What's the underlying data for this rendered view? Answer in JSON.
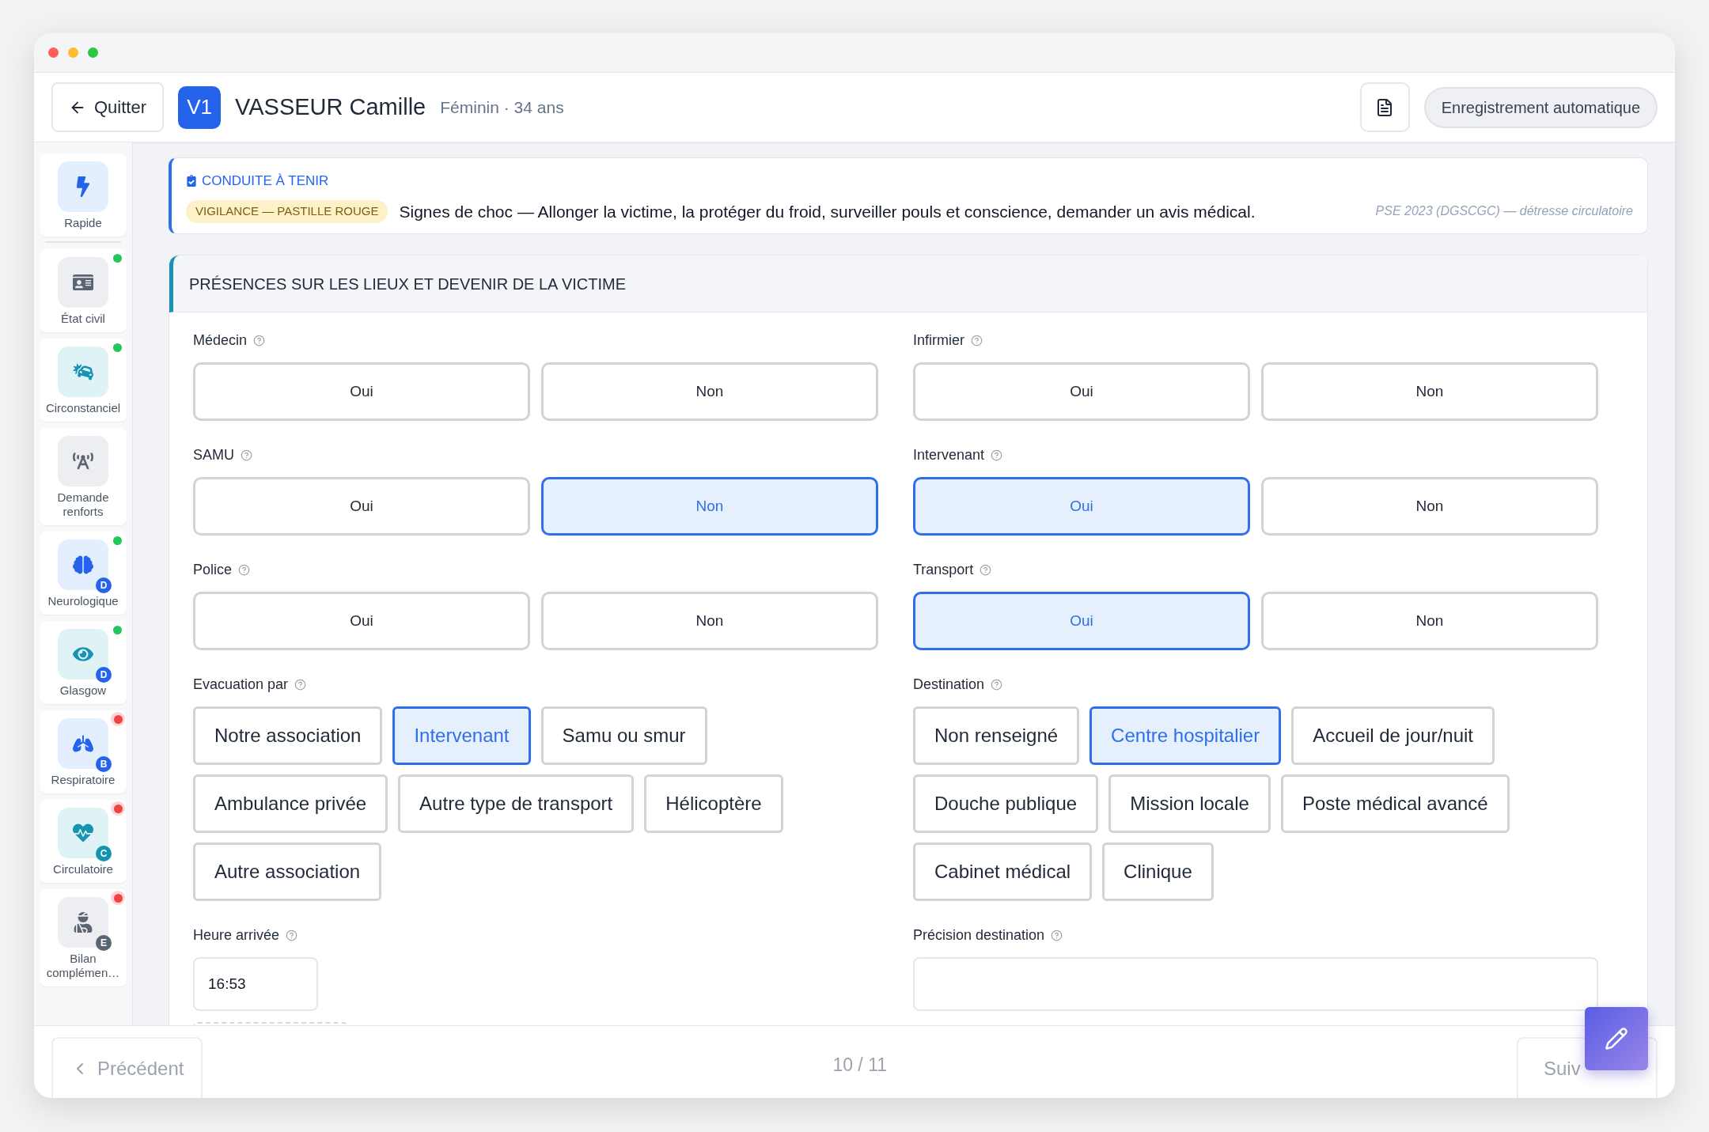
{
  "header": {
    "back_button": "Quitter",
    "avatar": "V1",
    "patient_name": "VASSEUR Camille",
    "patient_info": "Féminin · 34 ans",
    "autosave": "Enregistrement automatique"
  },
  "sidebar": {
    "items": [
      {
        "label": "Rapide",
        "complete": false,
        "alert": false
      },
      {
        "label": "État civil",
        "complete": true,
        "alert": false
      },
      {
        "label": "Circonstanciel",
        "complete": true,
        "alert": false
      },
      {
        "label": "Demande renforts",
        "complete": false,
        "alert": false
      },
      {
        "label": "Neurologique",
        "complete": true,
        "alert": false,
        "badge": "D"
      },
      {
        "label": "Glasgow",
        "complete": true,
        "alert": false,
        "badge": "D"
      },
      {
        "label": "Respiratoire",
        "alert": true,
        "badge": "B"
      },
      {
        "label": "Circulatoire",
        "alert": true,
        "badge": "C"
      },
      {
        "label": "Bilan complémen…",
        "alert": true,
        "badge": "E"
      }
    ]
  },
  "alert": {
    "title": "CONDUITE À TENIR",
    "tag": "VIGILANCE — PASTILLE ROUGE",
    "text": "Signes de choc — Allonger la victime, la protéger du froid, surveiller pouls et conscience, demander un avis médical.",
    "source": "PSE 2023 (DGSCGC) — détresse circulatoire"
  },
  "section": {
    "title": "PRÉSENCES SUR LES LIEUX ET DEVENIR DE LA VICTIME",
    "fields": [
      {
        "kind": "toggle",
        "label": "Médecin",
        "options": [
          {
            "label": "Oui",
            "selected": false
          },
          {
            "label": "Non",
            "selected": false
          }
        ]
      },
      {
        "kind": "toggle",
        "label": "Infirmier",
        "options": [
          {
            "label": "Oui",
            "selected": false
          },
          {
            "label": "Non",
            "selected": false
          }
        ]
      },
      {
        "kind": "toggle",
        "label": "SAMU",
        "options": [
          {
            "label": "Oui",
            "selected": false
          },
          {
            "label": "Non",
            "selected": true
          }
        ]
      },
      {
        "kind": "toggle",
        "label": "Intervenant",
        "options": [
          {
            "label": "Oui",
            "selected": true
          },
          {
            "label": "Non",
            "selected": false
          }
        ]
      },
      {
        "kind": "toggle",
        "label": "Police",
        "options": [
          {
            "label": "Oui",
            "selected": false
          },
          {
            "label": "Non",
            "selected": false
          }
        ]
      },
      {
        "kind": "toggle",
        "label": "Transport",
        "options": [
          {
            "label": "Oui",
            "selected": true
          },
          {
            "label": "Non",
            "selected": false
          }
        ]
      },
      {
        "kind": "chips",
        "label": "Evacuation par",
        "options": [
          {
            "label": "Notre association",
            "selected": false
          },
          {
            "label": "Intervenant",
            "selected": true
          },
          {
            "label": "Samu ou smur",
            "selected": false
          },
          {
            "label": "Ambulance privée",
            "selected": false
          },
          {
            "label": "Autre type de transport",
            "selected": false
          },
          {
            "label": "Hélicoptère",
            "selected": false
          },
          {
            "label": "Autre association",
            "selected": false
          }
        ]
      },
      {
        "kind": "chips",
        "label": "Destination",
        "options": [
          {
            "label": "Non renseigné",
            "selected": false
          },
          {
            "label": "Centre hospitalier",
            "selected": true
          },
          {
            "label": "Accueil de jour/nuit",
            "selected": false
          },
          {
            "label": "Douche publique",
            "selected": false
          },
          {
            "label": "Mission locale",
            "selected": false
          },
          {
            "label": "Poste médical avancé",
            "selected": false
          },
          {
            "label": "Cabinet médical",
            "selected": false
          },
          {
            "label": "Clinique",
            "selected": false
          }
        ]
      },
      {
        "kind": "time",
        "label": "Heure arrivée",
        "value": "16:53"
      },
      {
        "kind": "text",
        "label": "Précision destination"
      }
    ]
  },
  "footer": {
    "prev": {
      "label": "Précédent",
      "disabled": true
    },
    "page": "10 / 11",
    "next": {
      "label": "Suiv",
      "disabled": true
    }
  }
}
